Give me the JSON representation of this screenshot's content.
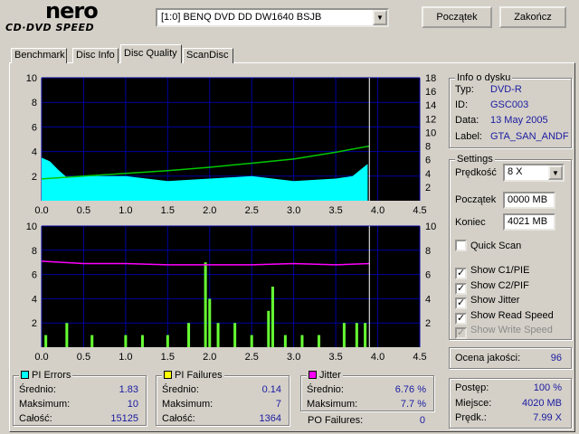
{
  "brand": {
    "logo": "nero",
    "sub": "CD·DVD SPEED"
  },
  "drive": {
    "value": "[1:0]  BENQ DVD DD DW1640 BSJB"
  },
  "buttons": {
    "start": "Początek",
    "end": "Zakończ"
  },
  "tabs": [
    "Benchmark",
    "Disc Info",
    "Disc Quality",
    "ScanDisc"
  ],
  "active_tab": "Disc Quality",
  "colors": {
    "pie": "#00ffff",
    "pif": "#66ff33",
    "jitter": "#ff00ff",
    "speed": "#00c800",
    "plot_bg": "#000000",
    "grid": "#0000a0"
  },
  "disc_info": {
    "title": "Info o dysku",
    "type_label": "Typ:",
    "type": "DVD-R",
    "id_label": "ID:",
    "id": "GSC003",
    "date_label": "Data:",
    "date": "13 May 2005",
    "label_label": "Label:",
    "label": "GTA_SAN_ANDF"
  },
  "settings": {
    "title": "Settings",
    "speed_label": "Prędkość",
    "speed": "8 X",
    "start_label": "Początek",
    "start": "0000 MB",
    "end_label": "Koniec",
    "end": "4021 MB",
    "quick_scan": "Quick Scan",
    "show_c1": "Show C1/PIE",
    "show_c2": "Show C2/PIF",
    "show_jitter": "Show Jitter",
    "show_read": "Show Read Speed",
    "show_write": "Show Write Speed"
  },
  "quality": {
    "label": "Ocena jakości:",
    "value": "96"
  },
  "progress": {
    "progress_label": "Postęp:",
    "progress": "100 %",
    "location_label": "Miejsce:",
    "location": "4020 MB",
    "speed_label": "Prędk.:",
    "speed": "7.99 X"
  },
  "pi_errors": {
    "title": "PI Errors",
    "avg_label": "Średnio:",
    "avg": "1.83",
    "max_label": "Maksimum:",
    "max": "10",
    "total_label": "Całość:",
    "total": "15125"
  },
  "pi_failures": {
    "title": "PI Failures",
    "avg_label": "Średnio:",
    "avg": "0.14",
    "max_label": "Maksimum:",
    "max": "7",
    "total_label": "Całość:",
    "total": "1364"
  },
  "jitter": {
    "title": "Jitter",
    "avg_label": "Średnio:",
    "avg": "6.76 %",
    "max_label": "Maksimum:",
    "max": "7.7 %",
    "po_label": "PO Failures:",
    "po": "0"
  },
  "chart_data": [
    {
      "type": "area",
      "xlim": [
        0.0,
        4.5
      ],
      "ylim_left": [
        0,
        10
      ],
      "ylim_right": [
        0,
        18
      ],
      "x_ticks": [
        "0.0",
        "0.5",
        "1.0",
        "1.5",
        "2.0",
        "2.5",
        "3.0",
        "3.5",
        "4.0",
        "4.5"
      ],
      "y_ticks_left": [
        "2",
        "4",
        "6",
        "8",
        "10"
      ],
      "y_ticks_right": [
        "2",
        "4",
        "6",
        "8",
        "10",
        "12",
        "14",
        "16",
        "18"
      ],
      "grid": true,
      "series": [
        {
          "name": "PI Errors",
          "x": [
            0.0,
            0.1,
            0.2,
            0.3,
            0.5,
            1.0,
            1.5,
            2.0,
            2.5,
            3.0,
            3.5,
            3.7,
            3.88
          ],
          "values": [
            3.5,
            3.2,
            2.5,
            1.9,
            2.0,
            2.0,
            1.6,
            1.8,
            2.0,
            1.6,
            1.8,
            2.0,
            3.0
          ]
        },
        {
          "name": "Read Speed",
          "x": [
            0.0,
            0.5,
            1.0,
            1.5,
            2.0,
            2.5,
            3.0,
            3.5,
            3.9
          ],
          "values": [
            3.2,
            3.6,
            4.0,
            4.4,
            4.9,
            5.5,
            6.1,
            7.1,
            8.0
          ]
        }
      ]
    },
    {
      "type": "bar",
      "xlim": [
        0.0,
        4.5
      ],
      "ylim_left": [
        0,
        10
      ],
      "ylim_right": [
        0,
        10
      ],
      "x_ticks": [
        "0.0",
        "0.5",
        "1.0",
        "1.5",
        "2.0",
        "2.5",
        "3.0",
        "3.5",
        "4.0",
        "4.5"
      ],
      "y_ticks_left": [
        "2",
        "4",
        "6",
        "8",
        "10"
      ],
      "y_ticks_right": [
        "2",
        "4",
        "6",
        "8",
        "10"
      ],
      "grid": true,
      "series": [
        {
          "name": "PI Failures",
          "x": [
            0.05,
            0.3,
            0.6,
            1.0,
            1.2,
            1.5,
            1.75,
            1.95,
            2.0,
            2.1,
            2.3,
            2.5,
            2.7,
            2.75,
            2.9,
            3.1,
            3.3,
            3.6,
            3.75,
            3.85
          ],
          "values": [
            1,
            2,
            1,
            1,
            1,
            1,
            2,
            7,
            4,
            2,
            2,
            1,
            3,
            5,
            1,
            1,
            1,
            2,
            2,
            2
          ]
        },
        {
          "name": "Jitter",
          "x": [
            0.0,
            0.5,
            1.0,
            1.5,
            2.0,
            2.5,
            3.0,
            3.5,
            3.9
          ],
          "values": [
            7.1,
            6.9,
            6.9,
            6.8,
            6.8,
            6.8,
            6.9,
            6.8,
            6.9
          ]
        }
      ]
    }
  ]
}
